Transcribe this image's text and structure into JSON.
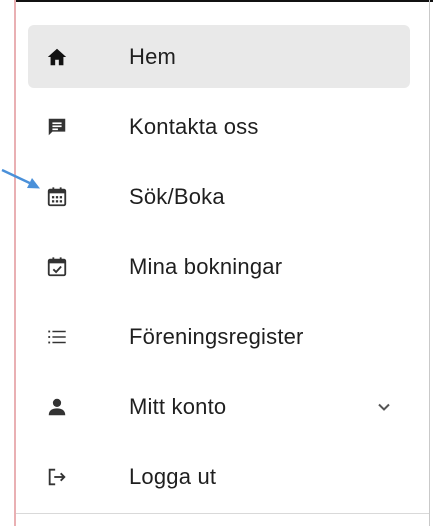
{
  "nav": {
    "items": [
      {
        "label": "Hem",
        "icon": "home-icon",
        "active": true
      },
      {
        "label": "Kontakta oss",
        "icon": "message-icon",
        "active": false
      },
      {
        "label": "Sök/Boka",
        "icon": "calendar-grid-icon",
        "active": false
      },
      {
        "label": "Mina bokningar",
        "icon": "calendar-check-icon",
        "active": false
      },
      {
        "label": "Föreningsregister",
        "icon": "list-icon",
        "active": false
      },
      {
        "label": "Mitt konto",
        "icon": "person-icon",
        "active": false,
        "expandable": true
      },
      {
        "label": "Logga ut",
        "icon": "logout-icon",
        "active": false
      }
    ]
  },
  "colors": {
    "active_background": "#e9e9e9",
    "text": "#1f1f1f",
    "icon": "#222222",
    "annotation_arrow": "#4a90d9",
    "chevron": "#555555"
  }
}
